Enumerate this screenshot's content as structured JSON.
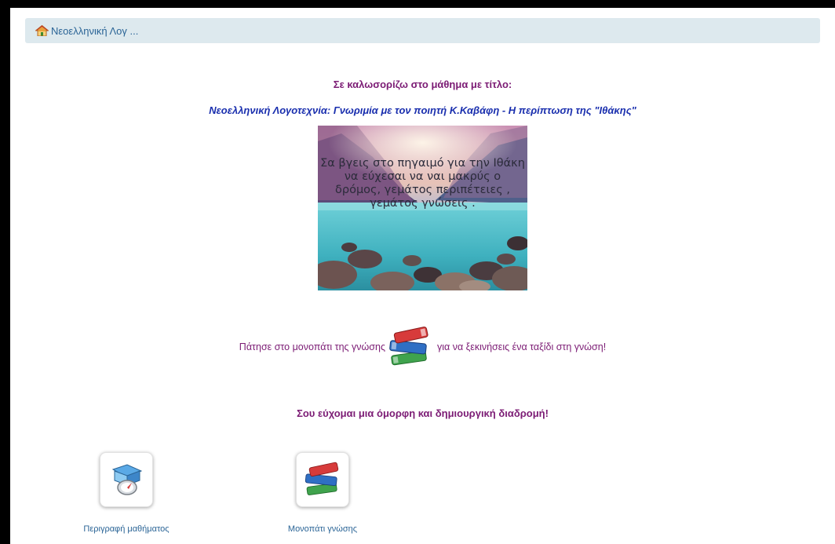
{
  "breadcrumb": {
    "home_icon": "home-icon",
    "label": "Νεοελληνική Λογ ..."
  },
  "welcome_text": "Σε καλωσορίζω στο μάθημα με τίτλο:",
  "course_title": "Νεοελληνική Λογοτεχνία: Γνωριμία με τον ποιητή Κ.Καβάφη -  Η περίπτωση της \"Ιθάκης\"",
  "hero_poem": {
    "line1": "Σα βγεις στο πηγαιμό για την Ιθάκη",
    "line2": "να εύχεσαι  να ναι μακρύς ο",
    "line3": "δρόμος, γεμάτος περιπέτειες ,",
    "line4": "γεμάτος γνώσεις ."
  },
  "path_line": {
    "before": "Πάτησε στο μονοπάτι της γνώσης",
    "icon": "books-icon",
    "after": "για να ξεκινήσεις ένα ταξίδι στη γνώση!"
  },
  "wish_text": "Σου εύχομαι μια όμορφη και δημιουργική διαδρομή!",
  "tiles": [
    {
      "label": "Περιγραφή μαθήματος",
      "icon": "compass-map-icon"
    },
    {
      "label": "Μονοπάτι γνώσης",
      "icon": "books-icon"
    }
  ],
  "colors": {
    "accent_purple": "#7b1b74",
    "title_blue": "#1a2fae",
    "link_blue": "#2a6496",
    "breadcrumb_bg": "#dde9ee"
  }
}
